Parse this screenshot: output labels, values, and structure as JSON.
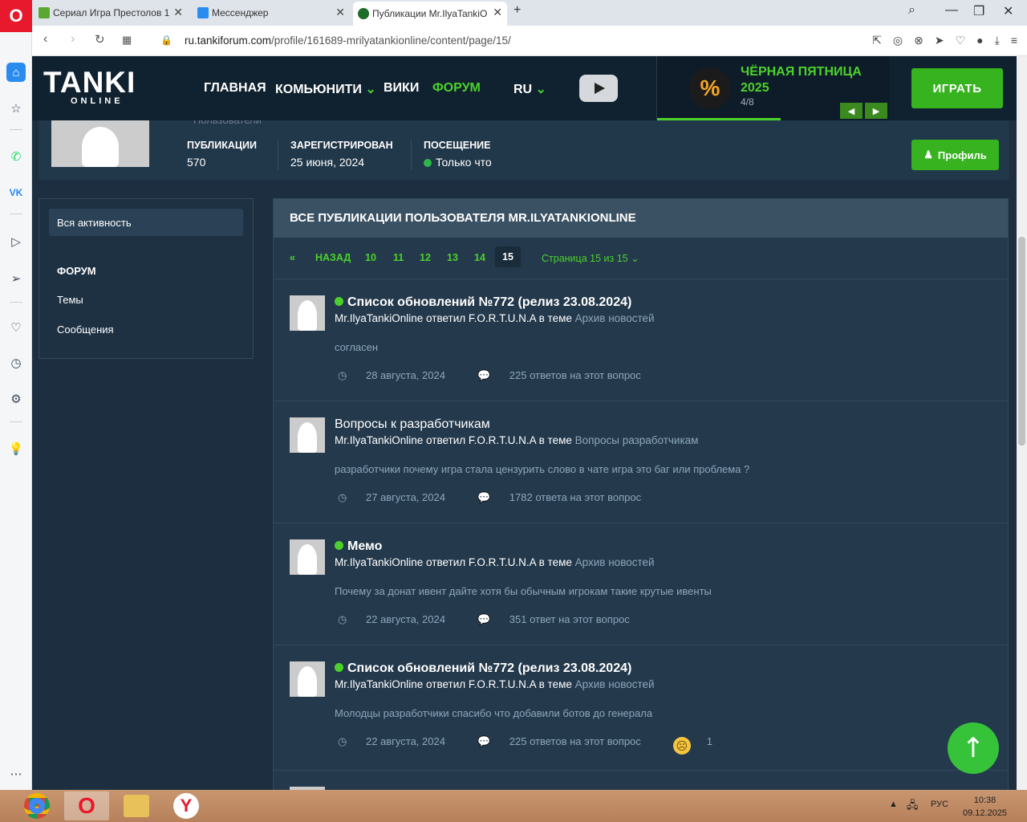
{
  "browser": {
    "tabs": [
      {
        "label": "Сериал Игра Престолов 1",
        "icon": "hd-icon",
        "color": "#5aa832"
      },
      {
        "label": "Мессенджер",
        "icon": "messenger-icon",
        "color": "#2b8cf0"
      },
      {
        "label": "Публикации Mr.IlyaTankiO",
        "icon": "tanki-icon",
        "color": "#1f6b2a"
      }
    ],
    "url_host": "ru.tankiforum.com",
    "url_path": "/profile/161689-mrilyatankionline/content/page/15/"
  },
  "site": {
    "logo_main": "TANKI",
    "logo_sub": "ONLINE",
    "nav": [
      "ГЛАВНАЯ",
      "КОМЬЮНИТИ",
      "ВИКИ",
      "ФОРУМ",
      "RU"
    ],
    "promo_title_1": "ЧЁРНАЯ ПЯТНИЦА",
    "promo_title_2": "2025",
    "promo_page": "4/8",
    "promo_badge": "%",
    "play_label": "ИГРАТЬ",
    "accent": "#4cd12c"
  },
  "profile": {
    "group": "Пользователи",
    "stats": [
      {
        "label": "ПУБЛИКАЦИИ",
        "value": "570"
      },
      {
        "label": "ЗАРЕГИСТРИРОВАН",
        "value": "25 июня, 2024"
      },
      {
        "label": "ПОСЕЩЕНИЕ",
        "value": "Только что"
      }
    ],
    "profile_button": "Профиль"
  },
  "left_panel": {
    "all_activity": "Вся активность",
    "section": "ФОРУМ",
    "items": [
      "Темы",
      "Сообщения"
    ]
  },
  "main": {
    "heading": "ВСЕ ПУБЛИКАЦИИ ПОЛЬЗОВАТЕЛЯ MR.ILYATANKIONLINE",
    "pager": {
      "first": "«",
      "back": "НАЗАД",
      "pages": [
        "10",
        "11",
        "12",
        "13",
        "14"
      ],
      "current": "15",
      "summary": "Страница 15 из 15"
    },
    "posts": [
      {
        "title": "Список обновлений №772 (релиз 23.08.2024)",
        "pinned": true,
        "meta": "Mr.IlyaTankiOnline ответил F.O.R.T.U.N.A в теме",
        "section": "Архив новостей",
        "text": "согласен",
        "date": "28 августа, 2024",
        "replies": "225 ответов на этот вопрос"
      },
      {
        "title": "Вопросы к разработчикам",
        "pinned": false,
        "meta": "Mr.IlyaTankiOnline ответил F.O.R.T.U.N.A в теме",
        "section": "Вопросы разработчикам",
        "text": "разработчики почему игра стала цензурить слово в чате игра это баг или проблема ?",
        "date": "27 августа, 2024",
        "replies": "1782 ответа на этот вопрос"
      },
      {
        "title": "Мемо",
        "pinned": true,
        "meta": "Mr.IlyaTankiOnline ответил F.O.R.T.U.N.A в теме",
        "section": "Архив новостей",
        "text": "Почему за донат ивент дайте хотя бы обычным игрокам такие крутые ивенты",
        "date": "22 августа, 2024",
        "replies": "351 ответ на этот вопрос"
      },
      {
        "title": "Список обновлений №772 (релиз 23.08.2024)",
        "pinned": true,
        "meta": "Mr.IlyaTankiOnline ответил F.O.R.T.U.N.A в теме",
        "section": "Архив новостей",
        "text": "Молодцы разработчики спасибо что добавили ботов до генерала",
        "date": "22 августа, 2024",
        "replies": "225 ответов на этот вопрос",
        "reaction_count": "1"
      }
    ]
  },
  "taskbar": {
    "lang": "РУС",
    "time": "10:38",
    "date": "09.12.2025"
  }
}
